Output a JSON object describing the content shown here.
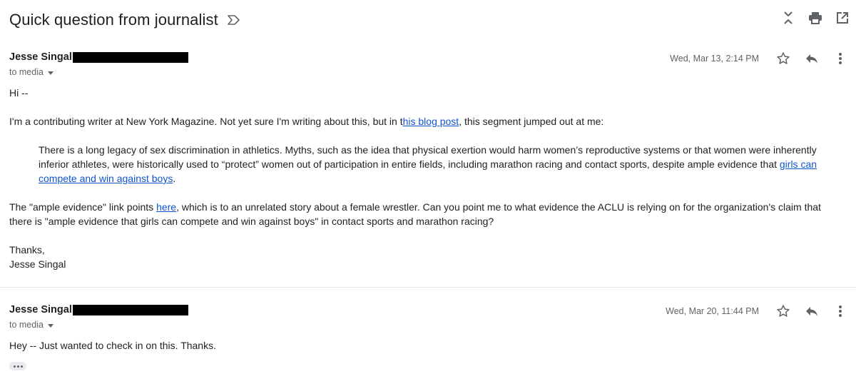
{
  "subject": "Quick question from journalist",
  "messages": [
    {
      "sender": "Jesse Singal",
      "to": "to media",
      "date": "Wed, Mar 13, 2:14 PM",
      "greeting": "Hi --",
      "p1_before": "I'm a contributing writer at New York Magazine. Not yet sure I'm writing about this, but in t",
      "p1_link": "his blog post",
      "p1_after": ", this segment jumped out at me:",
      "quote_text": "There is a long legacy of sex discrimination in athletics. Myths, such as the idea that physical exertion would harm women’s reproductive systems or that women were inherently inferior athletes, were historically used to “protect” women out of participation in entire fields, including marathon racing and contact sports, despite ample evidence that ",
      "quote_link": "girls can compete and win against boys",
      "quote_end": ".",
      "p2_before": "The \"ample evidence\" link points ",
      "p2_link": "here",
      "p2_after": ", which is to an unrelated story about a female wrestler. Can you point me to what evidence the ACLU is relying on for the organization's claim that there is \"ample evidence that girls can compete and win against boys\" in contact sports and marathon racing?",
      "signoff_1": "Thanks,",
      "signoff_2": "Jesse Singal"
    },
    {
      "sender": "Jesse Singal",
      "to": "to media",
      "date": "Wed, Mar 20, 11:44 PM",
      "body": "Hey -- Just wanted to check in on this. Thanks."
    }
  ],
  "icons": {
    "label": "label-outline-icon",
    "collapse": "collapse-all-icon",
    "print": "print-icon",
    "popout": "open-in-new-window-icon",
    "star": "star-outline-icon",
    "reply": "reply-icon",
    "more": "more-vert-icon",
    "trimmed": "show-trimmed-content-icon"
  },
  "colors": {
    "link": "#1155cc",
    "muted": "#5f6368",
    "redaction": "#000000"
  }
}
